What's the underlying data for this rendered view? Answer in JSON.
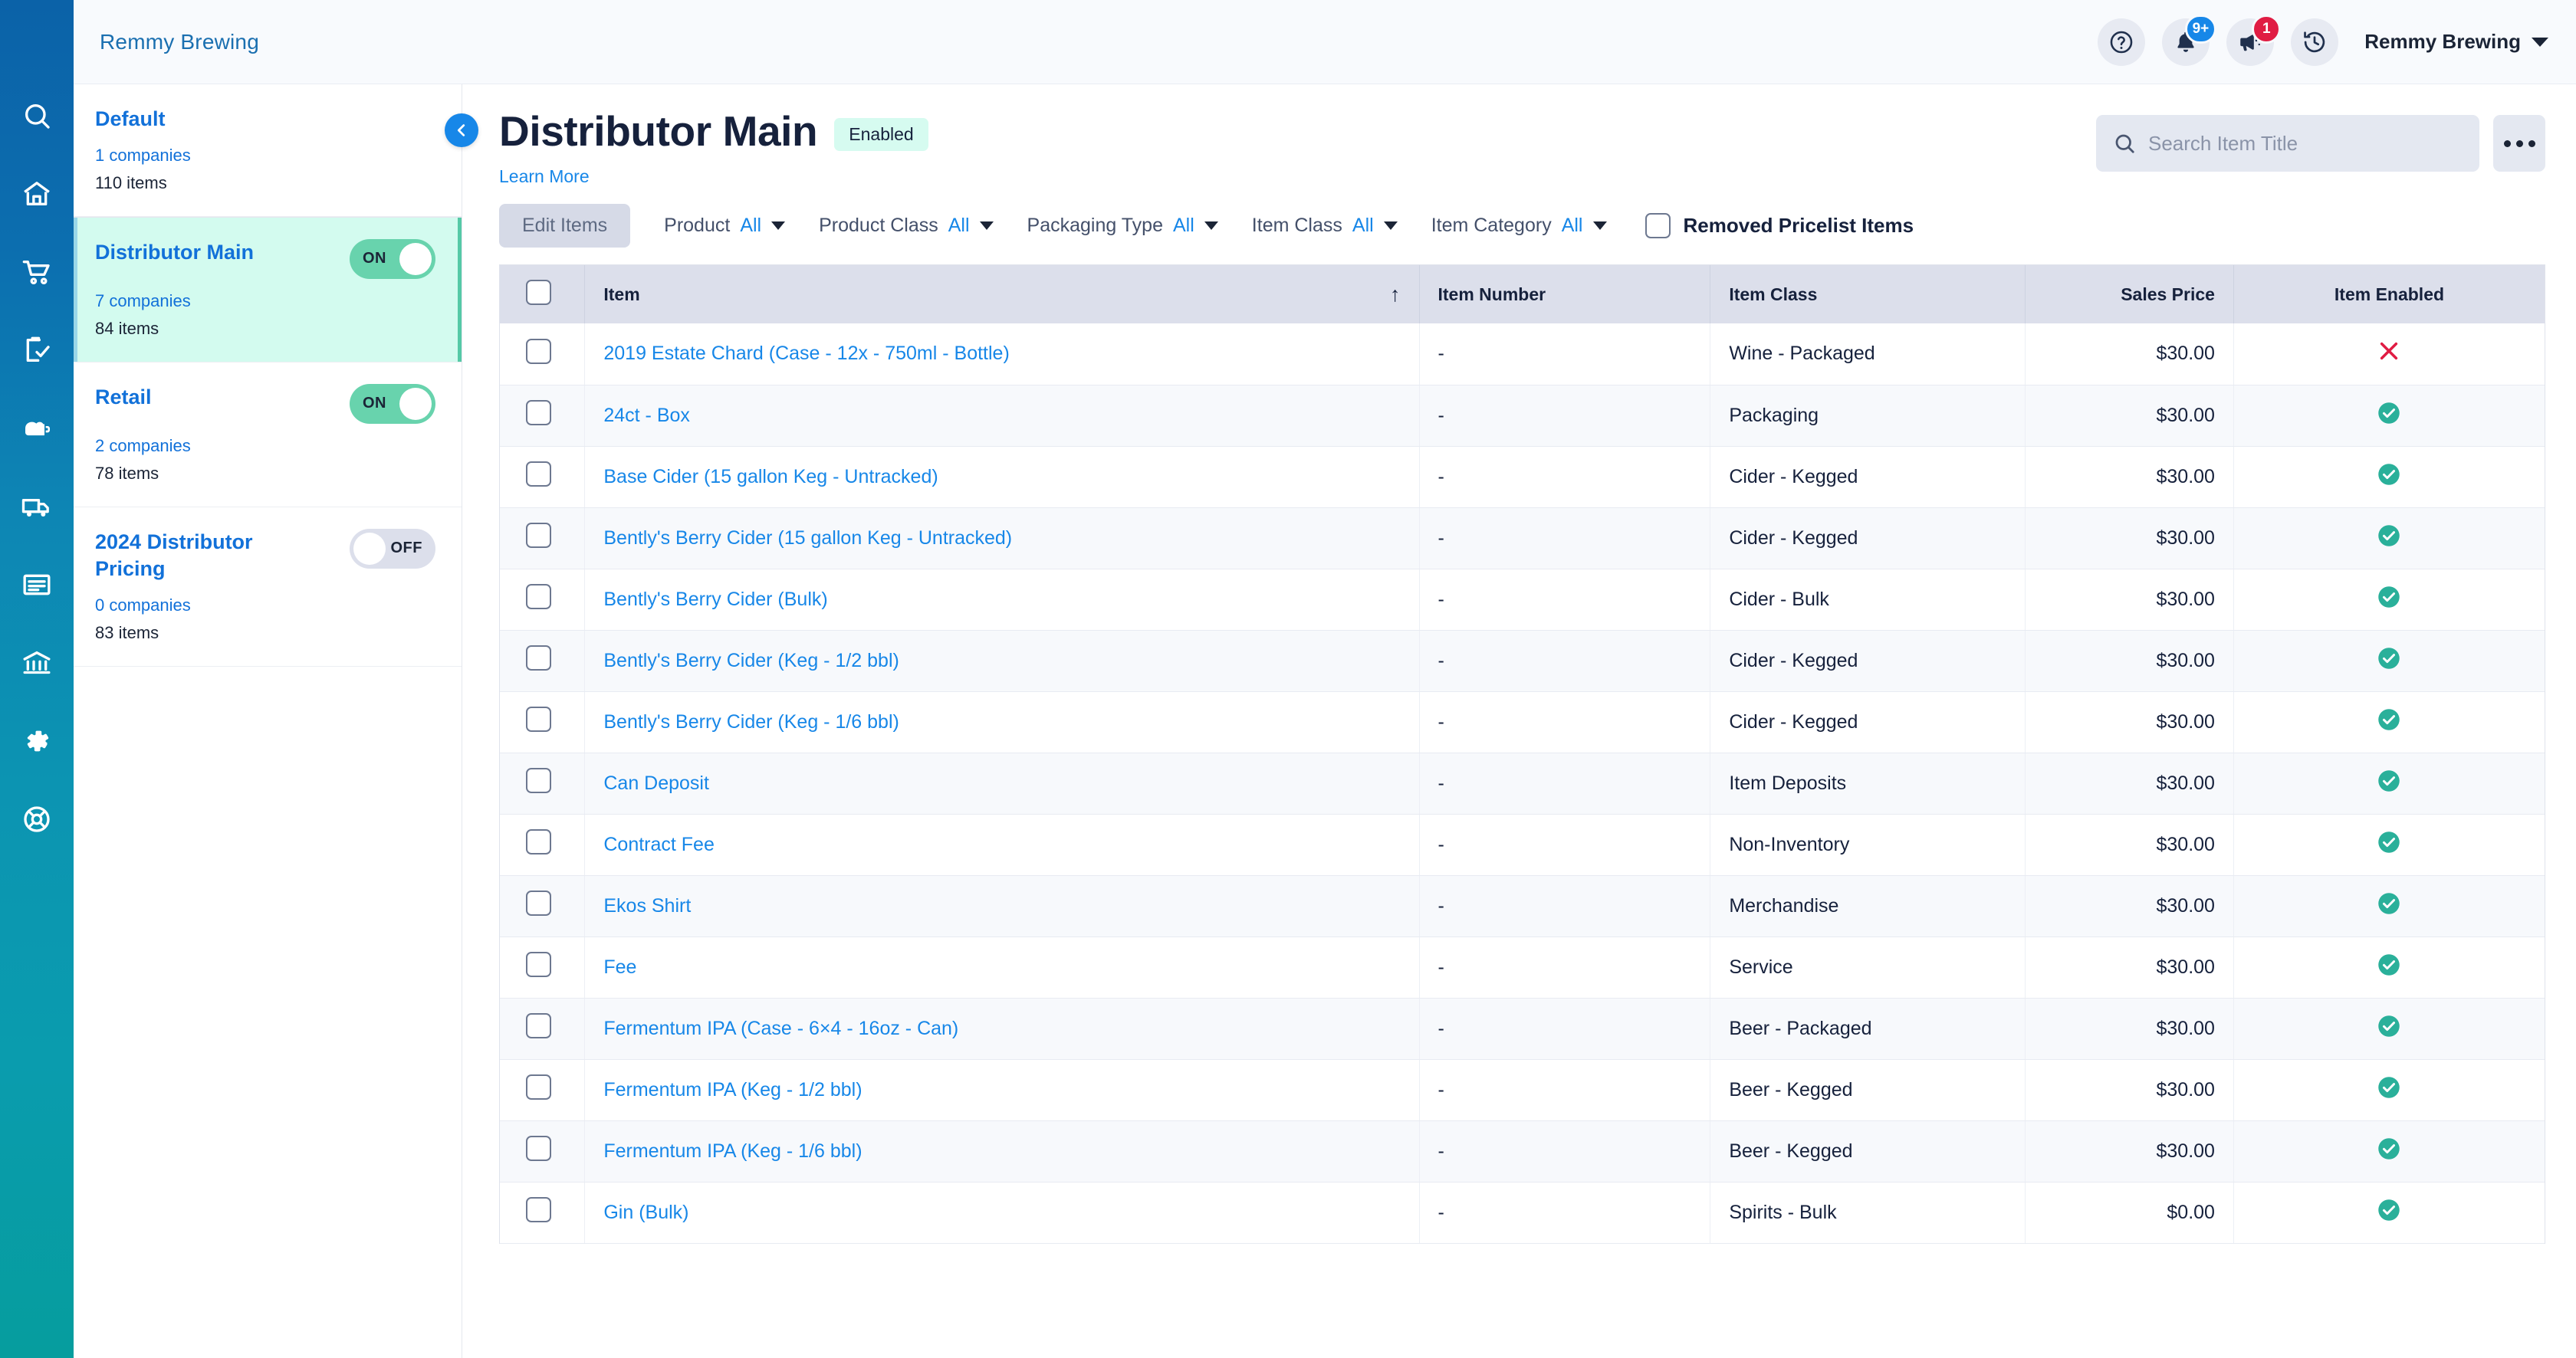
{
  "topbar": {
    "brand": "Remmy Brewing",
    "user_name": "Remmy Brewing",
    "help_icon": "question-circle-icon",
    "bell_badge": "9+",
    "megaphone_badge": "1"
  },
  "pricelists": [
    {
      "name": "Default",
      "companies": "1 companies",
      "items": "110 items",
      "toggle": null,
      "active": false
    },
    {
      "name": "Distributor Main",
      "companies": "7 companies",
      "items": "84 items",
      "toggle": "ON",
      "active": true
    },
    {
      "name": "Retail",
      "companies": "2 companies",
      "items": "78 items",
      "toggle": "ON",
      "active": false
    },
    {
      "name": "2024 Distributor Pricing",
      "companies": "0 companies",
      "items": "83 items",
      "toggle": "OFF",
      "active": false
    }
  ],
  "page": {
    "title": "Distributor Main",
    "status": "Enabled",
    "learn_more": "Learn More"
  },
  "search": {
    "placeholder": "Search Item Title",
    "value": ""
  },
  "filters": {
    "edit_items_label": "Edit Items",
    "dropdowns": [
      {
        "label": "Product",
        "value": "All"
      },
      {
        "label": "Product Class",
        "value": "All"
      },
      {
        "label": "Packaging Type",
        "value": "All"
      },
      {
        "label": "Item Class",
        "value": "All"
      },
      {
        "label": "Item Category",
        "value": "All"
      }
    ],
    "removed_pricelist_items": "Removed Pricelist Items"
  },
  "table": {
    "columns": [
      "Item",
      "Item Number",
      "Item Class",
      "Sales Price",
      "Item Enabled"
    ],
    "sort_column": "Item",
    "sort_direction": "asc",
    "rows": [
      {
        "item": "2019 Estate Chard (Case - 12x - 750ml - Bottle)",
        "number": "-",
        "class": "Wine - Packaged",
        "price": "$30.00",
        "enabled": false
      },
      {
        "item": "24ct - Box",
        "number": "-",
        "class": "Packaging",
        "price": "$30.00",
        "enabled": true
      },
      {
        "item": "Base Cider (15 gallon Keg - Untracked)",
        "number": "-",
        "class": "Cider - Kegged",
        "price": "$30.00",
        "enabled": true
      },
      {
        "item": "Bently's Berry Cider (15 gallon Keg - Untracked)",
        "number": "-",
        "class": "Cider - Kegged",
        "price": "$30.00",
        "enabled": true
      },
      {
        "item": "Bently's Berry Cider (Bulk)",
        "number": "-",
        "class": "Cider - Bulk",
        "price": "$30.00",
        "enabled": true
      },
      {
        "item": "Bently's Berry Cider (Keg - 1/2 bbl)",
        "number": "-",
        "class": "Cider - Kegged",
        "price": "$30.00",
        "enabled": true
      },
      {
        "item": "Bently's Berry Cider (Keg - 1/6 bbl)",
        "number": "-",
        "class": "Cider - Kegged",
        "price": "$30.00",
        "enabled": true
      },
      {
        "item": "Can Deposit",
        "number": "-",
        "class": "Item Deposits",
        "price": "$30.00",
        "enabled": true
      },
      {
        "item": "Contract Fee",
        "number": "-",
        "class": "Non-Inventory",
        "price": "$30.00",
        "enabled": true
      },
      {
        "item": "Ekos Shirt",
        "number": "-",
        "class": "Merchandise",
        "price": "$30.00",
        "enabled": true
      },
      {
        "item": "Fee",
        "number": "-",
        "class": "Service",
        "price": "$30.00",
        "enabled": true
      },
      {
        "item": "Fermentum IPA (Case - 6×4 - 16oz - Can)",
        "number": "-",
        "class": "Beer - Packaged",
        "price": "$30.00",
        "enabled": true
      },
      {
        "item": "Fermentum IPA (Keg - 1/2 bbl)",
        "number": "-",
        "class": "Beer - Kegged",
        "price": "$30.00",
        "enabled": true
      },
      {
        "item": "Fermentum IPA (Keg - 1/6 bbl)",
        "number": "-",
        "class": "Beer - Kegged",
        "price": "$30.00",
        "enabled": true
      },
      {
        "item": "Gin (Bulk)",
        "number": "-",
        "class": "Spirits - Bulk",
        "price": "$0.00",
        "enabled": true
      }
    ]
  },
  "rail_icons": [
    "hamburger-menu-icon",
    "search-icon",
    "home-icon",
    "shopping-cart-icon",
    "clipboard-check-icon",
    "brewing-kettle-icon",
    "delivery-truck-icon",
    "reports-icon",
    "bank-icon",
    "gear-icon",
    "lifebuoy-support-icon"
  ],
  "colors": {
    "rail_top": "#0B62A8",
    "rail_bottom": "#069D9E",
    "link": "#1787e8",
    "accent_green": "#68d3ad",
    "danger": "#e01c43",
    "active_row": "#d3fbef"
  }
}
